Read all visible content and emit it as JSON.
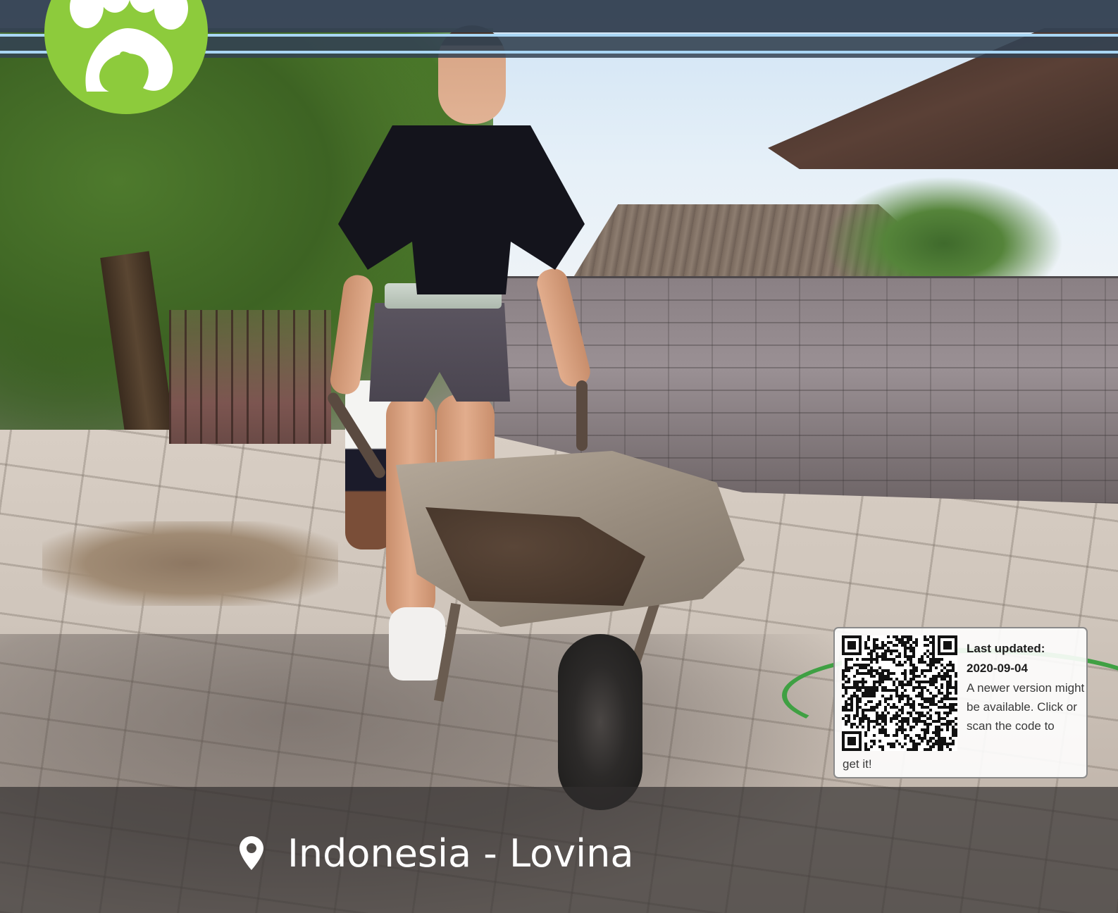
{
  "location": {
    "icon": "map-pin-icon",
    "text": "Indonesia - Lovina"
  },
  "logo": {
    "icon": "paw-print-icon",
    "background": "#8dcb3c"
  },
  "update_notice": {
    "label": "Last updated:",
    "date": "2020-09-04",
    "message_main": "A newer version might be available. Click or scan the code to",
    "message_tail": "get it!",
    "icon": "qr-code-icon"
  },
  "colors": {
    "top_bar": "#344252",
    "accent_line": "#a9d6f4",
    "bottom_bar": "#302e2e",
    "logo_green": "#8dcb3c"
  }
}
